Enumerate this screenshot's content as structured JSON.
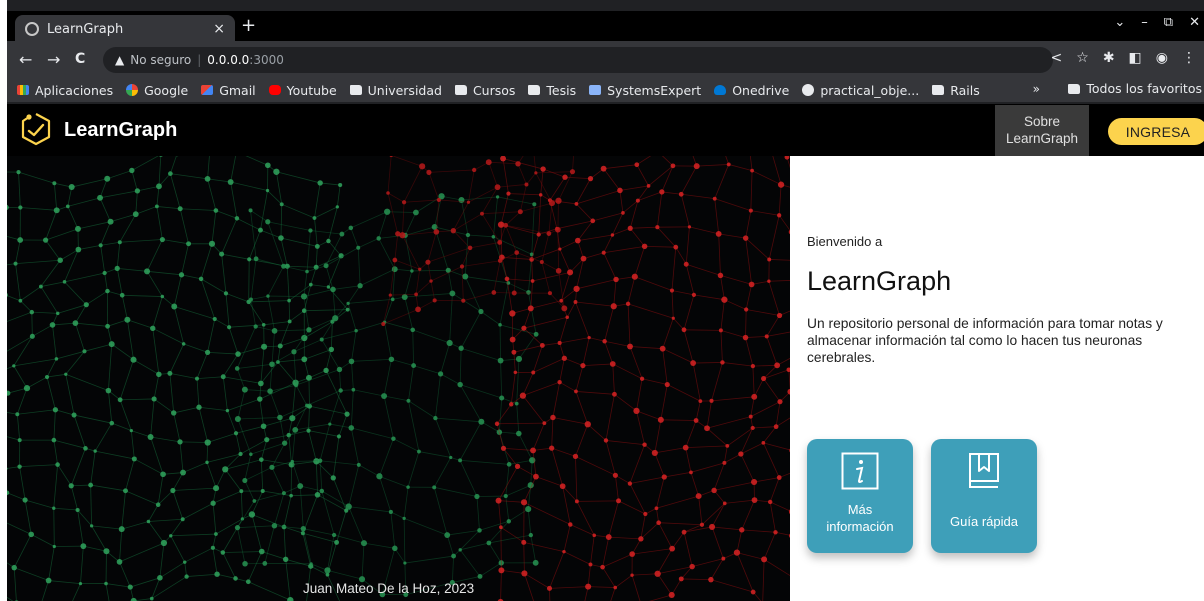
{
  "browser": {
    "tab": {
      "title": "LearnGraph",
      "close": "×"
    },
    "new_tab": "+",
    "window_controls": [
      "⌄",
      "–",
      "⧉",
      "✕"
    ],
    "nav": {
      "back": "←",
      "forward": "→",
      "reload": "C"
    },
    "omnibox": {
      "security_label": "No seguro",
      "separator": "|",
      "host": "0.0.0.0",
      "port": ":3000"
    },
    "toolbar_icons": [
      "share-icon",
      "star-icon",
      "extensions-icon",
      "sidepanel-icon",
      "profile-icon",
      "menu-icon"
    ],
    "bookmarks": [
      {
        "label": "Aplicaciones",
        "icon": "apps-icon"
      },
      {
        "label": "Google",
        "icon": "google-icon"
      },
      {
        "label": "Gmail",
        "icon": "gmail-icon"
      },
      {
        "label": "Youtube",
        "icon": "youtube-icon"
      },
      {
        "label": "Universidad",
        "icon": "folder-icon"
      },
      {
        "label": "Cursos",
        "icon": "folder-icon"
      },
      {
        "label": "Tesis",
        "icon": "folder-icon"
      },
      {
        "label": "SystemsExpert",
        "icon": "systemsexpert-icon"
      },
      {
        "label": "Onedrive",
        "icon": "onedrive-icon"
      },
      {
        "label": "practical_obje...",
        "icon": "github-icon"
      },
      {
        "label": "Rails",
        "icon": "folder-icon"
      }
    ],
    "bookmarks_more": "»",
    "all_bookmarks": "Todos los favoritos"
  },
  "app": {
    "brand": "LearnGraph",
    "about_button": "Sobre\nLearnGraph",
    "login_button": "INGRESA",
    "hero_credit": "Juan Mateo De la Hoz, 2023",
    "welcome": "Bienvenido a",
    "heading": "LearnGraph",
    "description": "Un repositorio personal de información para tomar notas y almacenar información tal como lo hacen tus neuronas cerebrales.",
    "cards": [
      {
        "label": "Más\ninformación",
        "icon": "info-icon"
      },
      {
        "label": "Guía rápida",
        "icon": "book-icon"
      }
    ],
    "colors": {
      "accent_yellow": "#fcd34d",
      "card_blue": "#3e9fb9",
      "appbar": "#000000"
    }
  }
}
